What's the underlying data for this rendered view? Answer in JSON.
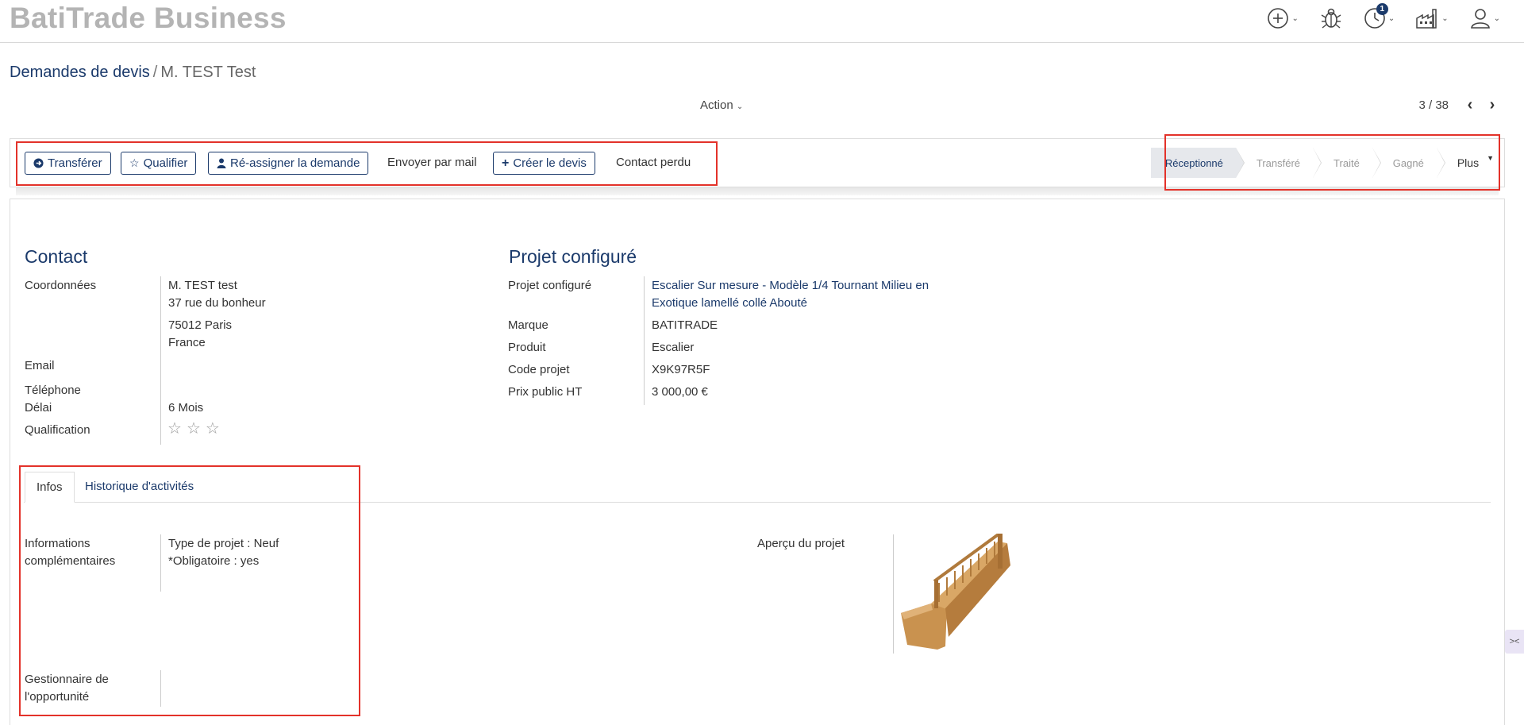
{
  "app": {
    "title": "BatiTrade Business"
  },
  "topbar": {
    "icons": [
      "add-circle-icon",
      "bug-icon",
      "activity-clock-icon",
      "factory-icon",
      "user-icon"
    ],
    "activity_badge": "1"
  },
  "breadcrumb": {
    "parent": "Demandes de devis",
    "separator": "/",
    "current": "M. TEST Test"
  },
  "toolbar": {
    "action_label": "Action",
    "pager": "3 / 38"
  },
  "buttons": {
    "transferer": "Transférer",
    "qualifier": "Qualifier",
    "reassigner": "Ré-assigner la demande",
    "envoyer_mail": "Envoyer par mail",
    "creer_devis": "Créer le devis",
    "contact_perdu": "Contact perdu"
  },
  "stages": {
    "receptionne": "Réceptionné",
    "transfere": "Transféré",
    "traite": "Traité",
    "gagne": "Gagné",
    "plus": "Plus"
  },
  "contact": {
    "title": "Contact",
    "coordonnees_label": "Coordonnées",
    "name": "M.  TEST  test",
    "street": "37 rue du bonheur",
    "city": "75012  Paris",
    "country": "France",
    "email_label": "Email",
    "email": "",
    "telephone_label": "Téléphone",
    "telephone": "",
    "delai_label": "Délai",
    "delai": "6 Mois",
    "qualification_label": "Qualification",
    "qualification_stars": 0,
    "qualification_max": 3
  },
  "projet": {
    "title": "Projet configuré",
    "projet_label": "Projet configuré",
    "projet_line1": "Escalier Sur mesure - Modèle 1/4 Tournant Milieu en",
    "projet_line2": "Exotique lamellé collé Abouté",
    "marque_label": "Marque",
    "marque": "BATITRADE",
    "produit_label": "Produit",
    "produit": "Escalier",
    "code_label": "Code projet",
    "code": "X9K97R5F",
    "prix_label": "Prix public HT",
    "prix": "3 000,00 €"
  },
  "tabs": {
    "infos": "Infos",
    "historique": "Historique d'activités"
  },
  "infos": {
    "info_comp_label_1": "Informations",
    "info_comp_label_2": "complémentaires",
    "info_line1": "Type de projet : Neuf",
    "info_line2": "*Obligatoire : yes",
    "apercu_label": "Aperçu du projet",
    "gestionnaire_label_1": "Gestionnaire de",
    "gestionnaire_label_2": "l'opportunité",
    "gestionnaire": ""
  },
  "side_toggle": "><"
}
